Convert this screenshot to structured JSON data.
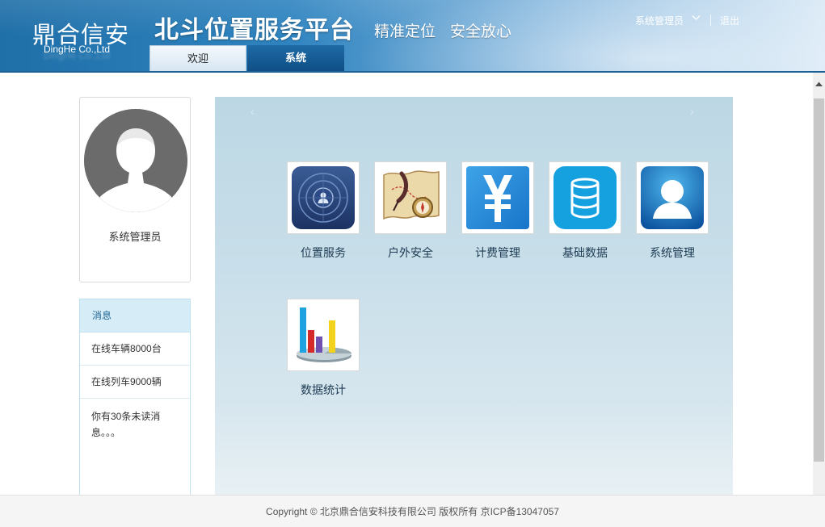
{
  "header": {
    "logo_cn": "鼎合信安",
    "logo_en": "DingHe Co.,Ltd",
    "platform_title": "北斗位置服务平台",
    "slogan_1": "精准定位",
    "slogan_2": "安全放心",
    "tabs": [
      {
        "label": "欢迎",
        "active": false
      },
      {
        "label": "系统",
        "active": true
      }
    ],
    "user_menu": "系统管理员",
    "logout": "退出"
  },
  "profile": {
    "name": "系统管理员"
  },
  "messages": {
    "title": "消息",
    "items": [
      "在线车辆8000台",
      "在线列车9000辆",
      "你有30条未读消息。。。"
    ]
  },
  "carousel": {
    "prev": "‹",
    "next": "›"
  },
  "apps": [
    {
      "label": "位置服务",
      "icon": "radar-icon"
    },
    {
      "label": "户外安全",
      "icon": "map-compass-icon"
    },
    {
      "label": "计费管理",
      "icon": "yen-icon"
    },
    {
      "label": "基础数据",
      "icon": "database-icon"
    },
    {
      "label": "系统管理",
      "icon": "user-icon"
    },
    {
      "label": "数据统计",
      "icon": "chart-icon"
    }
  ],
  "footer": {
    "copyright": "Copyright © 北京鼎合信安科技有限公司 版权所有 京ICP备13047057"
  },
  "colors": {
    "header_dark": "#1f6fa8",
    "tab_active": "#0f4f86",
    "main_bg": "#bcd7e4",
    "msg_header": "#d6ecf7"
  }
}
